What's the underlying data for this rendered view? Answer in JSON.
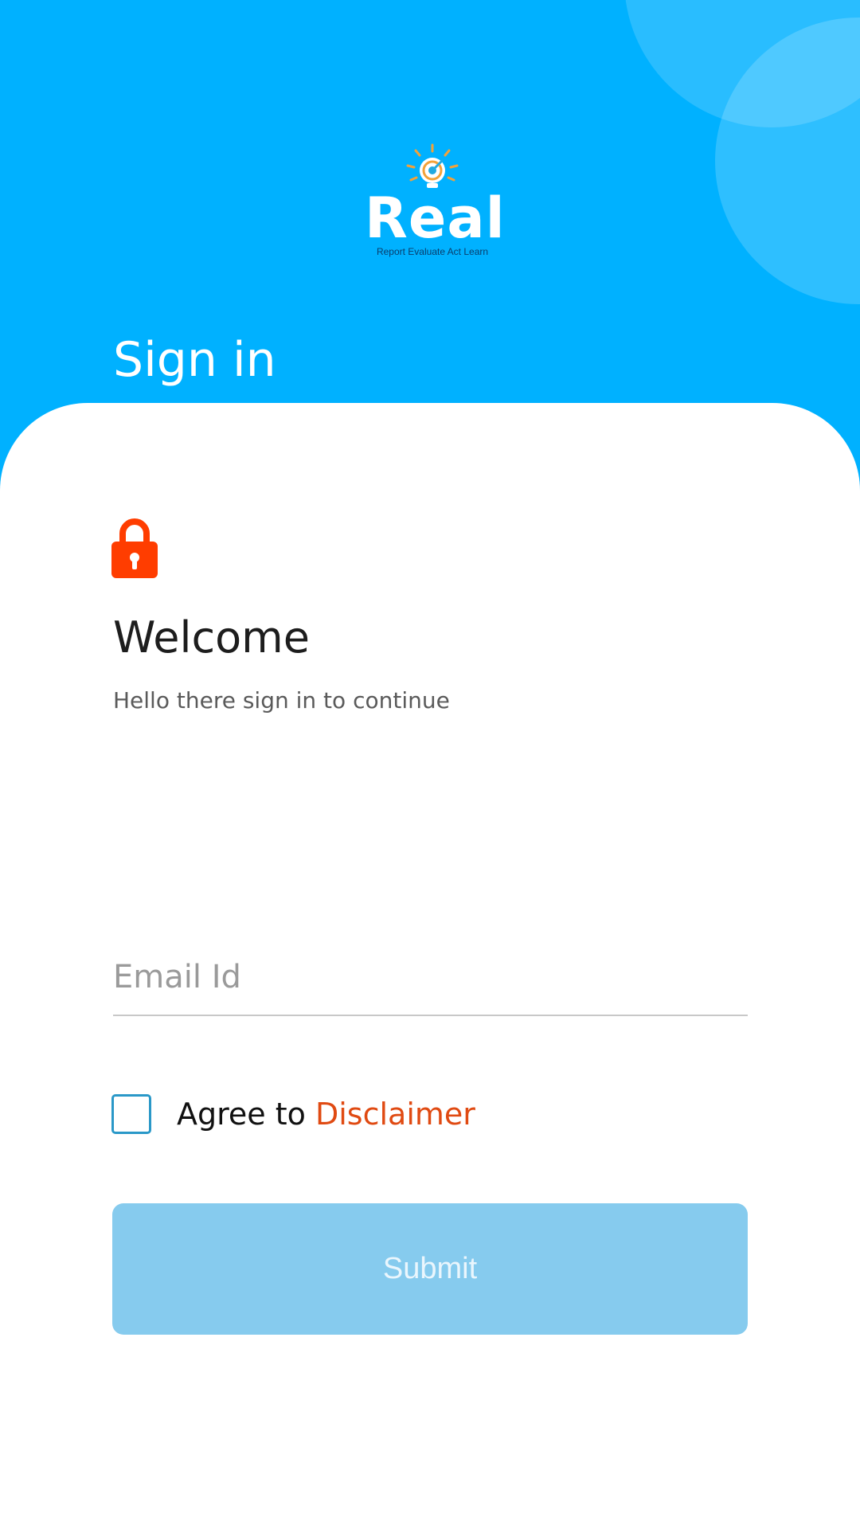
{
  "header": {
    "background_color": "#00B1FF",
    "logo": {
      "icon": "lightbulb-target-icon",
      "wordmark": "Real",
      "tagline": "Report Evaluate Act Learn"
    },
    "title": "Sign in"
  },
  "form": {
    "lock_icon": "lock-icon",
    "lock_color": "#FF3D00",
    "welcome": "Welcome",
    "subtitle": "Hello there sign in to continue",
    "email": {
      "placeholder": "Email Id",
      "value": ""
    },
    "agree": {
      "checked": false,
      "text": "Agree to",
      "link": "Disclaimer",
      "link_color": "#E04A12"
    },
    "submit": {
      "label": "Submit",
      "enabled": false,
      "color": "#86CBEE"
    }
  }
}
